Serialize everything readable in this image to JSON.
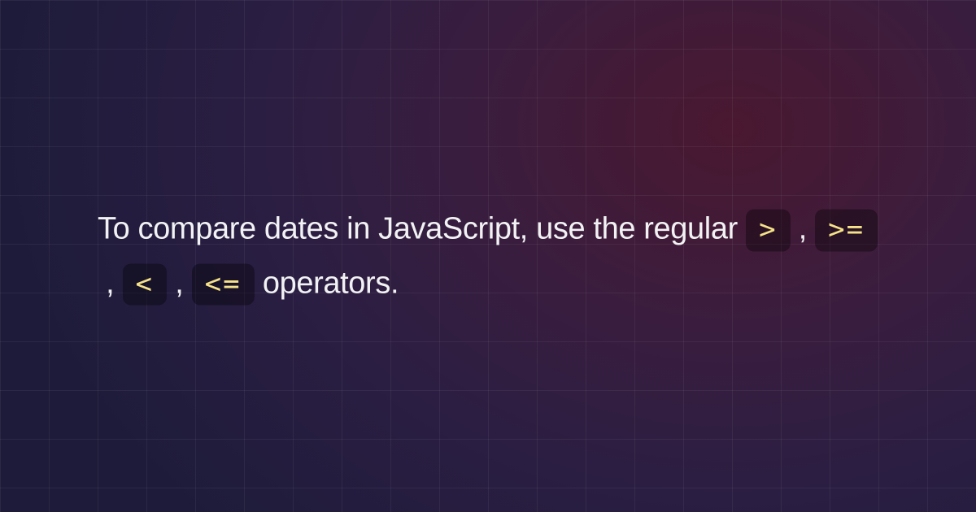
{
  "text": {
    "prefix": "To compare dates in JavaScript, use the regular ",
    "suffix": " operators.",
    "separator": " , "
  },
  "operators": [
    ">",
    ">=",
    "<",
    "<="
  ],
  "colors": {
    "code_text": "#f5e28a",
    "body_text": "#f2f2f4"
  }
}
